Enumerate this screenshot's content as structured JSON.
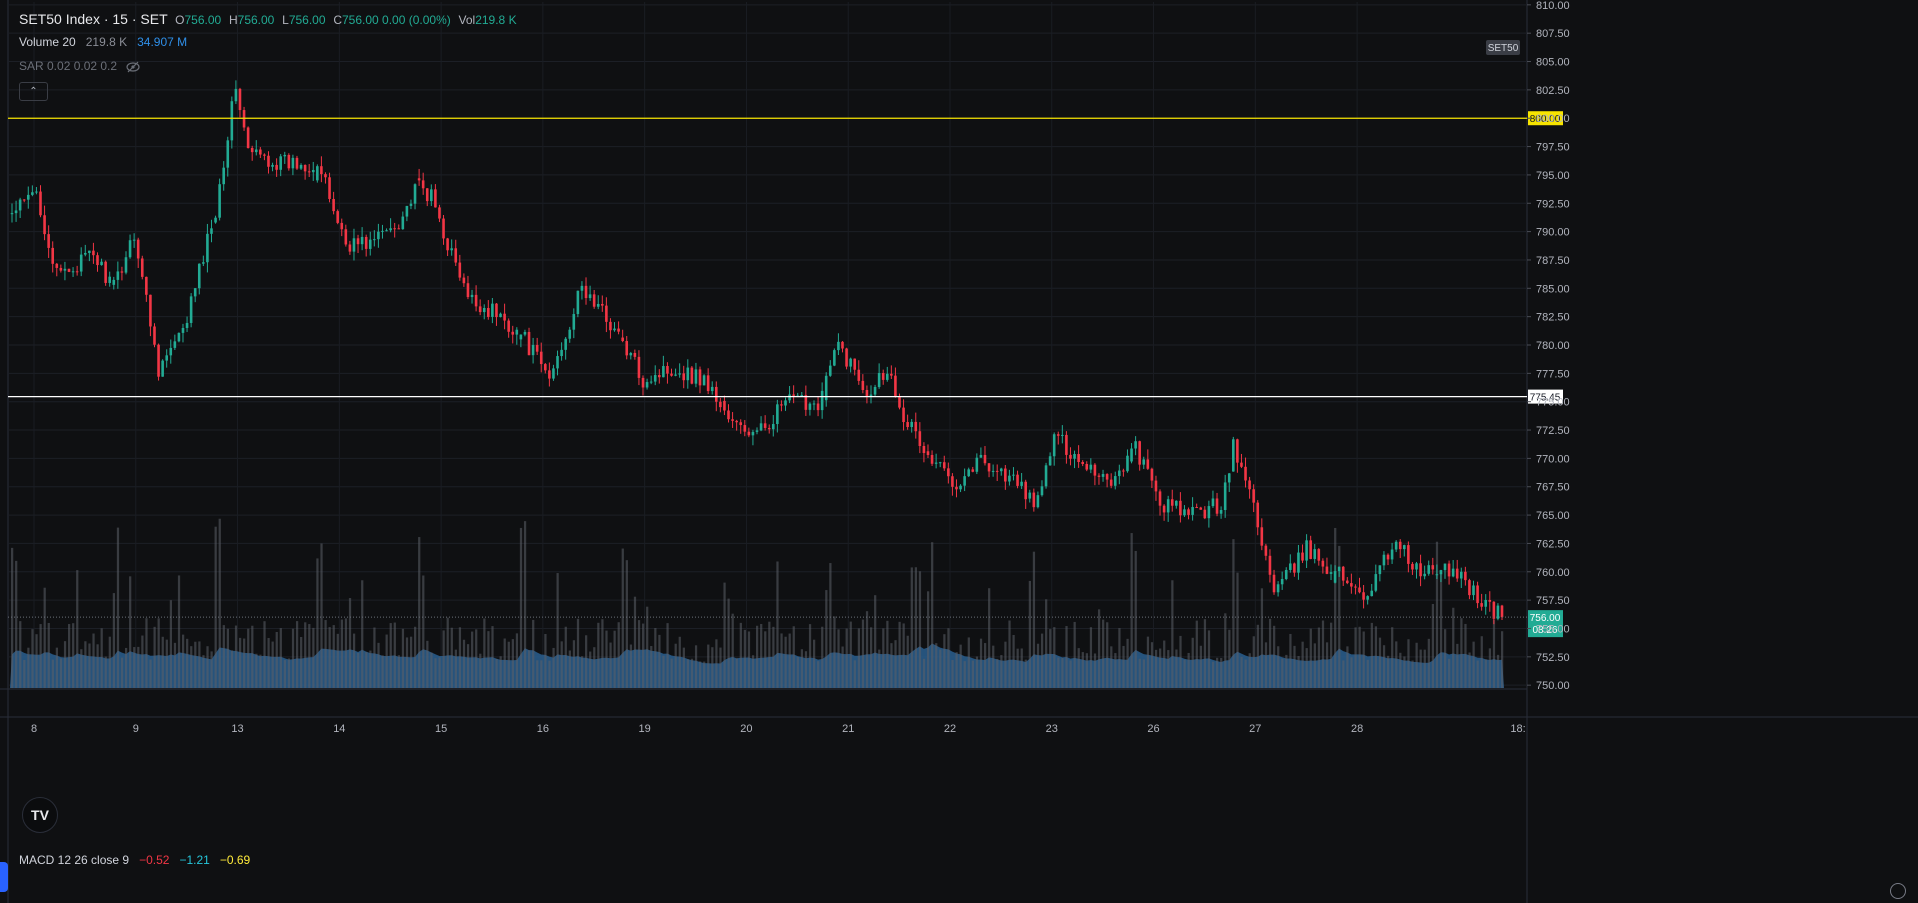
{
  "header": {
    "symbol": "SET50 Index · 15 · SET",
    "o_label": "O",
    "o_value": "756.00",
    "h_label": "H",
    "h_value": "756.00",
    "l_label": "L",
    "l_value": "756.00",
    "c_label": "C",
    "c_value": "756.00 0.00 (0.00%)",
    "vol_label": "Vol",
    "vol_value": "219.8 K"
  },
  "volume_legend": {
    "label": "Volume 20",
    "value1": "219.8 K",
    "value2": "34.907 M"
  },
  "sar_legend": {
    "label": "SAR 0.02 0.02 0.2"
  },
  "collapse_glyph": "⌃",
  "macd_legend": {
    "label": "MACD 12 26 close 9",
    "macd": "−0.52",
    "signal": "−1.21",
    "hist": "−0.69"
  },
  "logo_text": "TV",
  "colors": {
    "up": "#22ab94",
    "down": "#f23645",
    "yellow_line": "#f7e400",
    "white_line": "#ffffff",
    "volume_area": "#2a5f8f",
    "volume_bar": "#5d6068",
    "last_price_bg": "#22ab94"
  },
  "chart_data": {
    "type": "candlestick",
    "symbol_badge": "SET50",
    "y_ticks": [
      810,
      807.5,
      805,
      802.5,
      800,
      797.5,
      795,
      792.5,
      790,
      787.5,
      785,
      782.5,
      780,
      777.5,
      775,
      772.5,
      770,
      767.5,
      765,
      762.5,
      760,
      757.5,
      755,
      752.5,
      750
    ],
    "ylim": [
      749.75,
      810.25
    ],
    "x_ticks": [
      "8",
      "9",
      "13",
      "14",
      "15",
      "16",
      "19",
      "20",
      "21",
      "22",
      "23",
      "26",
      "27",
      "28",
      "18:"
    ],
    "session_starts_index": [
      0,
      25,
      50,
      75,
      100,
      125,
      150,
      175,
      200,
      225,
      250,
      275,
      300,
      325,
      348
    ],
    "horizontal_lines": [
      {
        "price": 800.0,
        "label": "800.00",
        "color": "#f7e400"
      },
      {
        "price": 775.45,
        "label": "775.45",
        "color": "#ffffff"
      }
    ],
    "last_price": {
      "price": 756.0,
      "label": "756.00",
      "countdown": "08:26"
    },
    "anchors": [
      [
        0,
        791.5
      ],
      [
        6,
        793.5
      ],
      [
        11,
        786
      ],
      [
        20,
        788
      ],
      [
        25,
        785
      ],
      [
        30,
        790
      ],
      [
        36,
        778
      ],
      [
        42,
        781
      ],
      [
        50,
        792
      ],
      [
        55,
        803
      ],
      [
        58,
        797
      ],
      [
        66,
        796
      ],
      [
        75,
        796
      ],
      [
        82,
        789
      ],
      [
        88,
        789
      ],
      [
        95,
        791
      ],
      [
        100,
        794
      ],
      [
        103,
        793
      ],
      [
        106,
        790
      ],
      [
        112,
        784
      ],
      [
        118,
        783
      ],
      [
        125,
        781
      ],
      [
        132,
        777
      ],
      [
        140,
        785
      ],
      [
        147,
        782
      ],
      [
        155,
        777
      ],
      [
        162,
        778
      ],
      [
        170,
        777
      ],
      [
        177,
        773
      ],
      [
        183,
        772
      ],
      [
        190,
        775
      ],
      [
        198,
        775
      ],
      [
        203,
        780
      ],
      [
        210,
        776
      ],
      [
        215,
        778
      ],
      [
        219,
        774
      ],
      [
        225,
        770
      ],
      [
        232,
        768
      ],
      [
        238,
        770
      ],
      [
        246,
        768
      ],
      [
        252,
        766
      ],
      [
        256,
        772
      ],
      [
        262,
        770
      ],
      [
        270,
        768
      ],
      [
        276,
        771
      ],
      [
        282,
        766
      ],
      [
        290,
        765
      ],
      [
        297,
        766
      ],
      [
        300,
        771
      ],
      [
        305,
        766
      ],
      [
        310,
        758
      ],
      [
        318,
        762
      ],
      [
        325,
        760
      ],
      [
        333,
        758
      ],
      [
        340,
        763
      ],
      [
        345,
        760
      ],
      [
        355,
        760
      ],
      [
        362,
        757
      ],
      [
        366,
        756
      ]
    ],
    "n_candles": 367
  }
}
